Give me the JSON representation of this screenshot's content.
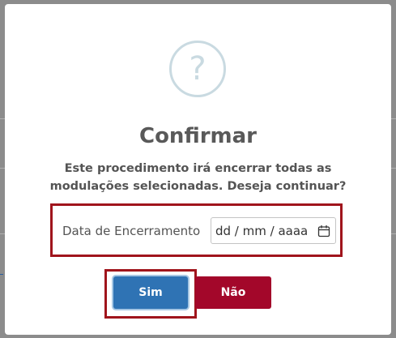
{
  "dialog": {
    "title": "Confirmar",
    "icon": "question-icon",
    "icon_glyph": "?",
    "message": "Este procedimento irá encerrar todas as modulações selecionadas. Deseja continuar?",
    "date_field": {
      "label": "Data de Encerramento",
      "placeholder": "dd / mm / aaaa",
      "value": ""
    },
    "buttons": {
      "confirm_label": "Sim",
      "cancel_label": "Não"
    }
  },
  "colors": {
    "confirm_button": "#2f73b4",
    "cancel_button": "#a3072a",
    "highlight_border": "#a0141c",
    "icon_ring": "#c9dae1"
  }
}
